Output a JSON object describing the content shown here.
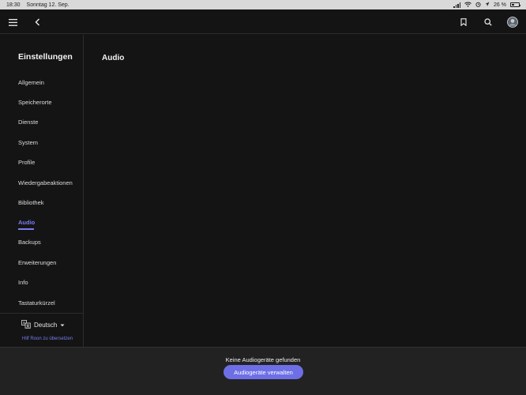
{
  "status_bar": {
    "time": "18:30",
    "date": "Sonntag 12. Sep.",
    "battery": "26 %"
  },
  "sidebar": {
    "title": "Einstellungen",
    "items": [
      {
        "label": "Allgemein"
      },
      {
        "label": "Speicherorte"
      },
      {
        "label": "Dienste"
      },
      {
        "label": "System"
      },
      {
        "label": "Profile"
      },
      {
        "label": "Wiedergabeaktionen"
      },
      {
        "label": "Bibliothek"
      },
      {
        "label": "Audio"
      },
      {
        "label": "Backups"
      },
      {
        "label": "Erweiterungen"
      },
      {
        "label": "Info"
      },
      {
        "label": "Tastaturkürzel"
      }
    ],
    "active_item": "Audio",
    "language": "Deutsch",
    "translate_link": "Hilf Roon zu übersetzen"
  },
  "main": {
    "title": "Audio"
  },
  "bottom_bar": {
    "message": "Keine Audiogeräte gefunden",
    "button_label": "Audiogeräte verwalten"
  },
  "colors": {
    "accent": "#7b7cf0",
    "button": "#6e6fe6",
    "background": "#141414"
  }
}
